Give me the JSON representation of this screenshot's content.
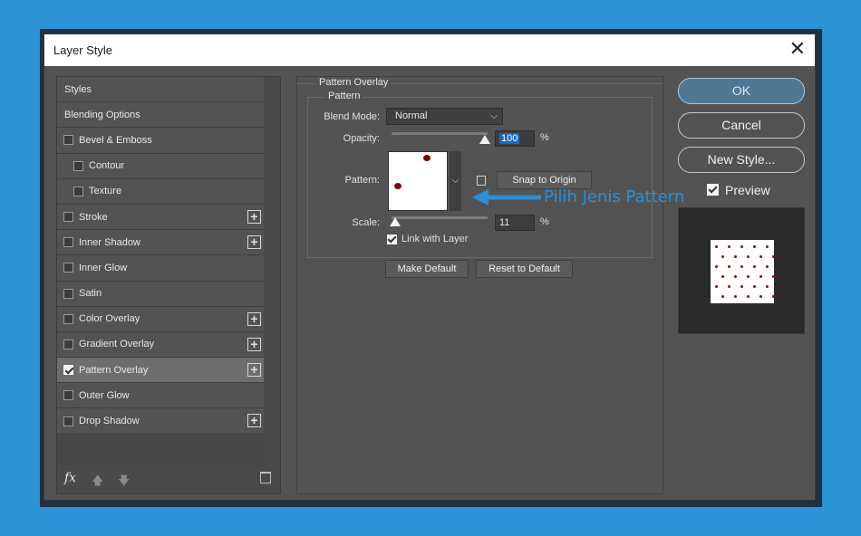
{
  "window": {
    "title": "Layer Style",
    "close_glyph": "✕"
  },
  "styles_panel": {
    "items": [
      {
        "label": "Styles",
        "checkbox": false,
        "checked": false,
        "indent": false,
        "plus": false,
        "selected": false
      },
      {
        "label": "Blending Options",
        "checkbox": false,
        "checked": false,
        "indent": false,
        "plus": false,
        "selected": false
      },
      {
        "label": "Bevel & Emboss",
        "checkbox": true,
        "checked": false,
        "indent": false,
        "plus": false,
        "selected": false
      },
      {
        "label": "Contour",
        "checkbox": true,
        "checked": false,
        "indent": true,
        "plus": false,
        "selected": false
      },
      {
        "label": "Texture",
        "checkbox": true,
        "checked": false,
        "indent": true,
        "plus": false,
        "selected": false
      },
      {
        "label": "Stroke",
        "checkbox": true,
        "checked": false,
        "indent": false,
        "plus": true,
        "selected": false
      },
      {
        "label": "Inner Shadow",
        "checkbox": true,
        "checked": false,
        "indent": false,
        "plus": true,
        "selected": false
      },
      {
        "label": "Inner Glow",
        "checkbox": true,
        "checked": false,
        "indent": false,
        "plus": false,
        "selected": false
      },
      {
        "label": "Satin",
        "checkbox": true,
        "checked": false,
        "indent": false,
        "plus": false,
        "selected": false
      },
      {
        "label": "Color Overlay",
        "checkbox": true,
        "checked": false,
        "indent": false,
        "plus": true,
        "selected": false
      },
      {
        "label": "Gradient Overlay",
        "checkbox": true,
        "checked": false,
        "indent": false,
        "plus": true,
        "selected": false
      },
      {
        "label": "Pattern Overlay",
        "checkbox": true,
        "checked": true,
        "indent": false,
        "plus": true,
        "selected": true
      },
      {
        "label": "Outer Glow",
        "checkbox": true,
        "checked": false,
        "indent": false,
        "plus": false,
        "selected": false
      },
      {
        "label": "Drop Shadow",
        "checkbox": true,
        "checked": false,
        "indent": false,
        "plus": true,
        "selected": false
      }
    ],
    "plus_glyph": "+",
    "footer": {
      "fx": "fx",
      "up": "🡅",
      "down": "🡇"
    }
  },
  "pattern_overlay": {
    "section_title": "Pattern Overlay",
    "group_title": "Pattern",
    "blend_mode_label": "Blend Mode:",
    "blend_mode_value": "Normal",
    "opacity_label": "Opacity:",
    "opacity_value": "100",
    "opacity_unit": "%",
    "opacity_level": 1.0,
    "pattern_label": "Pattern:",
    "snap_button": "Snap to Origin",
    "scale_label": "Scale:",
    "scale_value": "11",
    "scale_unit": "%",
    "link_label": "Link with Layer",
    "link_checked": true,
    "make_default": "Make Default",
    "reset_default": "Reset to Default",
    "dropdown_glyph": "⌵"
  },
  "actions": {
    "ok": "OK",
    "cancel": "Cancel",
    "new_style": "New Style...",
    "preview_label": "Preview",
    "preview_checked": true
  },
  "annotation": {
    "text": "Pilih Jenis Pattern",
    "color": "#2a8fd8"
  },
  "colors": {
    "background": "#2b93d6",
    "panel": "#535353",
    "accent_ok": "#4f7796",
    "pattern_dot": "#7a0a0a"
  }
}
